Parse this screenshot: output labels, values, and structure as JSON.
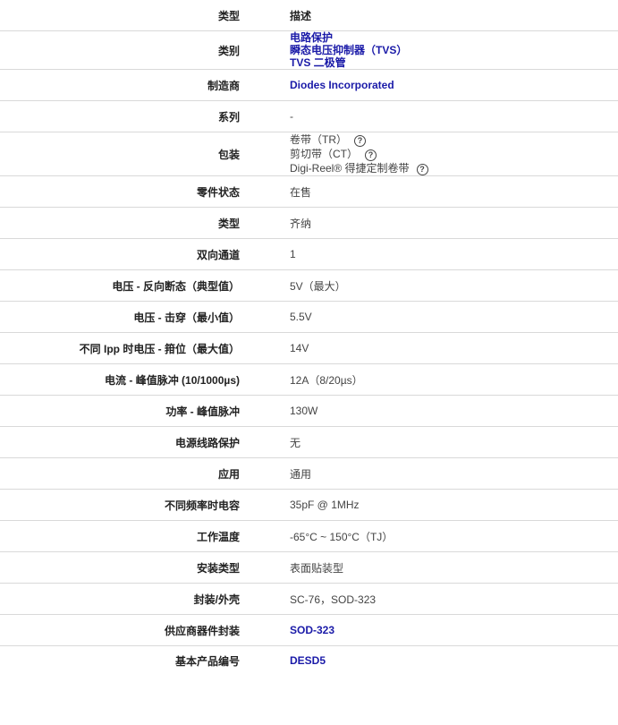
{
  "header": {
    "key": "类型",
    "value": "描述"
  },
  "category": {
    "key": "类别",
    "links": [
      "电路保护",
      "瞬态电压抑制器（TVS）",
      "TVS 二极管"
    ]
  },
  "manufacturer": {
    "key": "制造商",
    "value": "Diodes Incorporated"
  },
  "series": {
    "key": "系列",
    "value": "-"
  },
  "packaging": {
    "key": "包装",
    "options": [
      "卷带（TR）",
      "剪切带（CT）",
      "Digi-Reel® 得捷定制卷带"
    ],
    "help_glyph": "?"
  },
  "rows": [
    {
      "key": "零件状态",
      "value": "在售"
    },
    {
      "key": "类型",
      "value": "齐纳"
    },
    {
      "key": "双向通道",
      "value": "1"
    },
    {
      "key": "电压 - 反向断态（典型值）",
      "value": "5V（最大）"
    },
    {
      "key": "电压 - 击穿（最小值）",
      "value": "5.5V"
    },
    {
      "key": "不同 Ipp 时电压 - 箝位（最大值）",
      "value": "14V"
    },
    {
      "key": "电流 - 峰值脉冲 (10/1000µs)",
      "value": "12A（8/20µs）"
    },
    {
      "key": "功率 - 峰值脉冲",
      "value": "130W"
    },
    {
      "key": "电源线路保护",
      "value": "无"
    },
    {
      "key": "应用",
      "value": "通用"
    },
    {
      "key": "不同频率时电容",
      "value": "35pF @ 1MHz"
    },
    {
      "key": "工作温度",
      "value": "-65°C ~ 150°C（TJ）"
    },
    {
      "key": "安装类型",
      "value": "表面贴装型"
    },
    {
      "key": "封装/外壳",
      "value": "SC-76，SOD-323"
    }
  ],
  "supplier_package": {
    "key": "供应商器件封装",
    "value": "SOD-323"
  },
  "base_part": {
    "key": "基本产品编号",
    "value": "DESD5"
  }
}
